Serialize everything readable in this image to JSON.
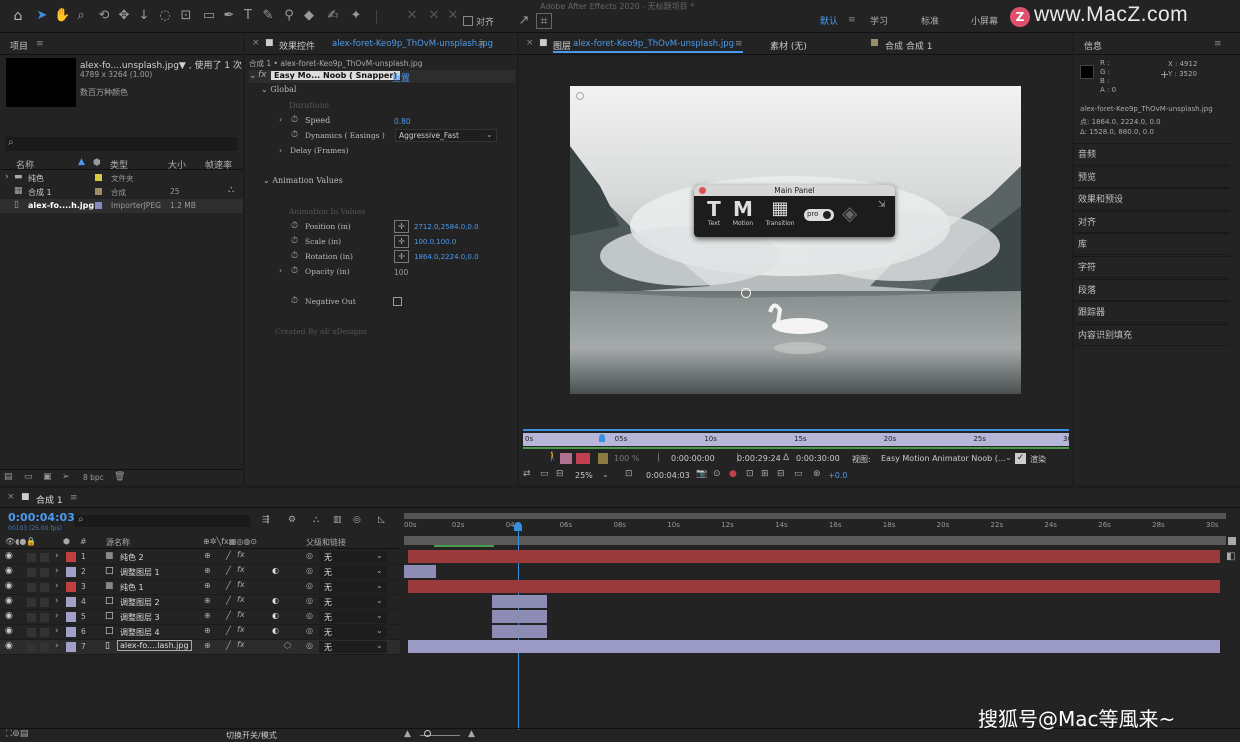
{
  "app_title": "Adobe After Effects 2020 - 无标题项目 *",
  "toolbar": {
    "align_label": "对齐",
    "workspaces": [
      "默认",
      "学习",
      "标准",
      "小屏幕"
    ],
    "active_workspace": "默认",
    "tool_icons": [
      "home-icon",
      "selection-tool-icon",
      "hand-tool-icon",
      "zoom-tool-icon",
      "orbit-camera-icon",
      "pan-camera-icon",
      "dolly-camera-icon",
      "pan-behind-icon",
      "rectangle-tool-icon",
      "pen-tool-icon",
      "type-tool-icon",
      "brush-tool-icon",
      "clone-stamp-icon",
      "eraser-tool-icon",
      "roto-brush-icon",
      "puppet-pin-icon"
    ]
  },
  "watermark_top": "www.MacZ.com",
  "watermark_bottom": "搜狐号@Mac等風来~",
  "project": {
    "title": "项目",
    "file_name": "alex-fo....unsplash.jpg▼ , 使用了 1 次",
    "file_size": "4789 x 3264 (1.00)",
    "file_color": "数百万种颜色",
    "col_name": "名称",
    "col_type": "类型",
    "col_size": "大小",
    "col_rate": "帧速率",
    "items": [
      {
        "name": "纯色",
        "type": "文件夹",
        "size": "",
        "color": "#d8c840",
        "icon": "folder-icon"
      },
      {
        "name": "合成 1",
        "type": "合成",
        "size": "25",
        "color": "#9b8f6a",
        "icon": "composition-icon"
      },
      {
        "name": "alex-fo....h.jpg",
        "type": "ImporterJPEG",
        "size": "1.2 MB",
        "color": "#8a8abc",
        "icon": "image-file-icon"
      }
    ],
    "bpc": "8 bpc"
  },
  "effects": {
    "tab_label": "效果控件",
    "tab_file": "alex-foret-Keo9p_ThOvM-unsplash.jpg",
    "breadcrumb": "合成 1 • alex-foret-Keo9p_ThOvM-unsplash.jpg",
    "effect_name": "Easy Mo... Noob ( Snapper)",
    "reset": "重置",
    "global": "Global",
    "durations": "Durations",
    "speed_label": "Speed",
    "speed_value": "0.80",
    "dynamics_label": "Dynamics ( Easings )",
    "dynamics_value": "Aggressive_Fast",
    "delay_label": "Delay (Frames)",
    "anim_values": "Animation Values",
    "anim_in_values": "Animation In Values",
    "position_label": "Position (in)",
    "position_value": "2712.0,2584.0,0.0",
    "scale_label": "Scale (in)",
    "scale_value": "100.0,100.0",
    "rotation_label": "Rotation (in)",
    "rotation_value": "1864.0,2224.0,0.0",
    "opacity_label": "Opacity (in)",
    "opacity_value": "100",
    "negative_label": "Negative Out",
    "credit": "Created By aE xDesigns"
  },
  "viewer": {
    "tab_layer": "图层",
    "tab_layer_file": "alex-foret-Keo9p_ThOvM-unsplash.jpg",
    "tab_footage": "素材 (无)",
    "tab_comp": "合成 合成 1",
    "main_panel_title": "Main Panel",
    "panel_buttons": [
      {
        "glyph": "T",
        "label": "Text"
      },
      {
        "glyph": "M",
        "label": "Motion"
      },
      {
        "glyph": "▦",
        "label": "Transition"
      }
    ],
    "pro_label": "pro",
    "ruler_ticks": [
      "0s",
      "05s",
      "10s",
      "15s",
      "20s",
      "25s",
      "30s"
    ],
    "time_in": "0:00:00:00",
    "time_out": "0:00:29:24",
    "duration": "0:00:30:00",
    "view_label": "视图:",
    "view_value": "Easy Motion Animator Noob (...",
    "render_label": "渲染",
    "opacity_pct": "100 %",
    "zoom": "25%",
    "current_time": "0:00:04:03",
    "exposure": "+0.0"
  },
  "info": {
    "title": "信息",
    "r": "R :",
    "g": "G :",
    "b": "B :",
    "a": "A : 0",
    "x": "X : 4912",
    "y": "Y : 3520",
    "file": "alex-foret-Keo9p_ThOvM-unsplash.jpg",
    "point": "点: 1864.0, 2224.0, 0.0",
    "delta": "Δ: 1528.0, 880.0, 0.0",
    "sections": [
      "音频",
      "预览",
      "效果和预设",
      "对齐",
      "库",
      "字符",
      "段落",
      "跟踪器",
      "内容识别填充"
    ]
  },
  "timeline": {
    "comp_tab": "合成 1",
    "time": "0:00:04:03",
    "fps": "00103 (25.00 fps)",
    "col_source": "源名称",
    "col_parent": "父级和链接",
    "ruler": [
      "00s",
      "02s",
      "04s",
      "06s",
      "08s",
      "10s",
      "12s",
      "14s",
      "16s",
      "18s",
      "20s",
      "22s",
      "24s",
      "26s",
      "28s",
      "30s"
    ],
    "layers": [
      {
        "num": "1",
        "name": "纯色 2",
        "color": "#c04040",
        "parent": "无"
      },
      {
        "num": "2",
        "name": "调整图层 1",
        "color": "#a0a0c8",
        "parent": "无"
      },
      {
        "num": "3",
        "name": "纯色 1",
        "color": "#c04040",
        "parent": "无"
      },
      {
        "num": "4",
        "name": "调整图层 2",
        "color": "#a0a0c8",
        "parent": "无"
      },
      {
        "num": "5",
        "name": "调整图层 3",
        "color": "#a0a0c8",
        "parent": "无"
      },
      {
        "num": "6",
        "name": "调整图层 4",
        "color": "#a0a0c8",
        "parent": "无"
      },
      {
        "num": "7",
        "name": "alex-fo....lash.jpg",
        "color": "#a0a0c8",
        "parent": "无"
      }
    ],
    "footer_toggle": "切换开关/模式"
  }
}
